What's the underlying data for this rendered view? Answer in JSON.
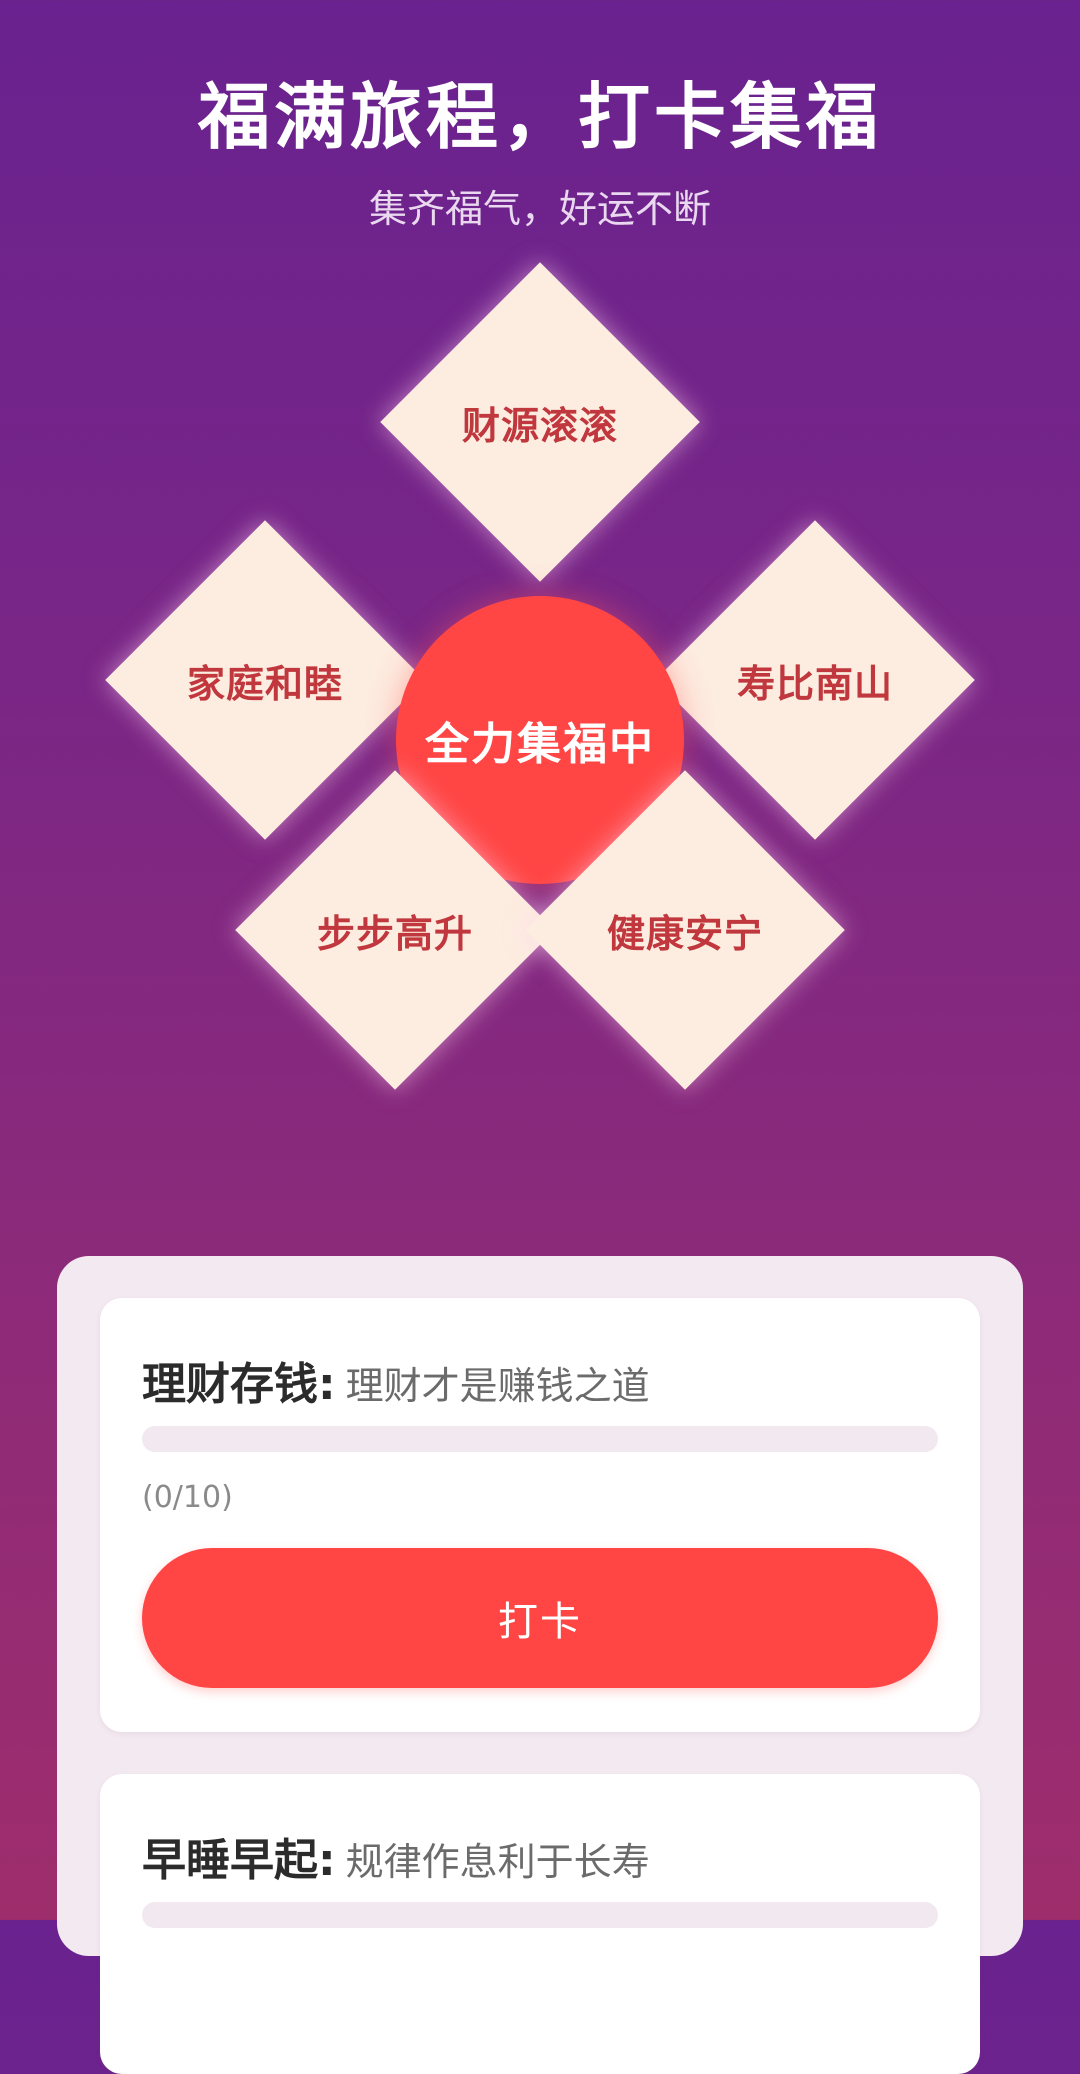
{
  "header": {
    "title": "福满旅程，打卡集福",
    "subtitle": "集齐福气，好运不断"
  },
  "blessings": {
    "top": "财源滚滚",
    "left": "家庭和睦",
    "right": "寿比南山",
    "bottom_left": "步步高升",
    "bottom_right": "健康安宁",
    "center": "全力集福中"
  },
  "tasks": [
    {
      "name": "理财存钱:",
      "description": "理财才是赚钱之道",
      "progress_count": "(0/10)",
      "progress_fraction": 0,
      "button_label": "打卡"
    },
    {
      "name": "早睡早起:",
      "description": "规律作息利于长寿",
      "progress_fraction": 0
    }
  ],
  "colors": {
    "accent_red": "#ff4645",
    "tile_bg": "#fdece0",
    "tile_text": "#c0373e",
    "bg_top": "#69228f",
    "bg_bottom": "#9e2d6c"
  }
}
